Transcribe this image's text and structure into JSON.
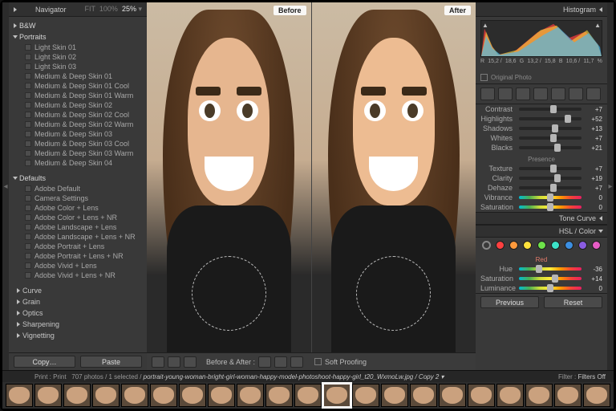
{
  "left": {
    "header": "Navigator",
    "fitlabel": "FIT",
    "fitpct": "100%",
    "zoom": "25%",
    "firstline": "B&W",
    "group1": "Portraits",
    "presets1": [
      "Light Skin 01",
      "Light Skin 02",
      "Light Skin 03",
      "Medium & Deep Skin 01",
      "Medium & Deep Skin 01 Cool",
      "Medium & Deep Skin 01 Warm",
      "Medium & Deep Skin 02",
      "Medium & Deep Skin 02 Cool",
      "Medium & Deep Skin 02 Warm",
      "Medium & Deep Skin 03",
      "Medium & Deep Skin 03 Cool",
      "Medium & Deep Skin 03 Warm",
      "Medium & Deep Skin 04"
    ],
    "group2": "Defaults",
    "presets2": [
      "Adobe Default",
      "Camera Settings",
      "Adobe Color + Lens",
      "Adobe Color + Lens + NR",
      "Adobe Landscape + Lens",
      "Adobe Landscape + Lens + NR",
      "Adobe Portrait + Lens",
      "Adobe Portrait + Lens + NR",
      "Adobe Vivid + Lens",
      "Adobe Vivid + Lens + NR"
    ],
    "collapsed": [
      "Curve",
      "Grain",
      "Optics",
      "Sharpening",
      "Vignetting"
    ],
    "copy": "Copy…",
    "paste": "Paste"
  },
  "center": {
    "before": "Before",
    "after": "After",
    "balabel": "Before & After :",
    "softproof": "Soft Proofing"
  },
  "right": {
    "header": "Histogram",
    "histvals": [
      "R",
      "15,2 /",
      "18,6",
      "G",
      "13,2 /",
      "15,8",
      "B",
      "10,6 /",
      "11,7",
      "%"
    ],
    "original": "Original Photo",
    "sliders": [
      {
        "l": "Contrast",
        "v": "+7",
        "p": 55
      },
      {
        "l": "Highlights",
        "v": "+52",
        "p": 78
      },
      {
        "l": "Shadows",
        "v": "+13",
        "p": 58
      },
      {
        "l": "Whites",
        "v": "+7",
        "p": 55
      },
      {
        "l": "Blacks",
        "v": "+21",
        "p": 62
      }
    ],
    "presence": "Presence",
    "sliders2": [
      {
        "l": "Texture",
        "v": "+7",
        "p": 55
      },
      {
        "l": "Clarity",
        "v": "+19",
        "p": 61
      },
      {
        "l": "Dehaze",
        "v": "+7",
        "p": 55
      }
    ],
    "sliders3": [
      {
        "l": "Vibrance",
        "v": "0",
        "p": 50
      },
      {
        "l": "Saturation",
        "v": "0",
        "p": 50
      }
    ],
    "tone": "Tone Curve",
    "hsl": "HSL / Color",
    "colors": [
      "#ff4040",
      "#ff9a3c",
      "#ffe23c",
      "#6ee24a",
      "#3ce2c9",
      "#3c8fe2",
      "#8a5ce2",
      "#e75cc6"
    ],
    "subhead": "Red",
    "hslsliders": [
      {
        "l": "Hue",
        "v": "-36",
        "p": 32
      },
      {
        "l": "Saturation",
        "v": "+14",
        "p": 58
      },
      {
        "l": "Luminance",
        "v": "0",
        "p": 50
      }
    ],
    "prev": "Previous",
    "reset": "Reset"
  },
  "bottom": {
    "left": "Print : Print",
    "count": "707 photos / 1 selected /",
    "path": "portrait-young-woman-bright-girl-woman-happy-model-photoshoot-happy-girl_t20_WxmoLw.jpg / Copy 2 ▾",
    "filter": "Filter :",
    "filtersOff": "Filters Off"
  }
}
